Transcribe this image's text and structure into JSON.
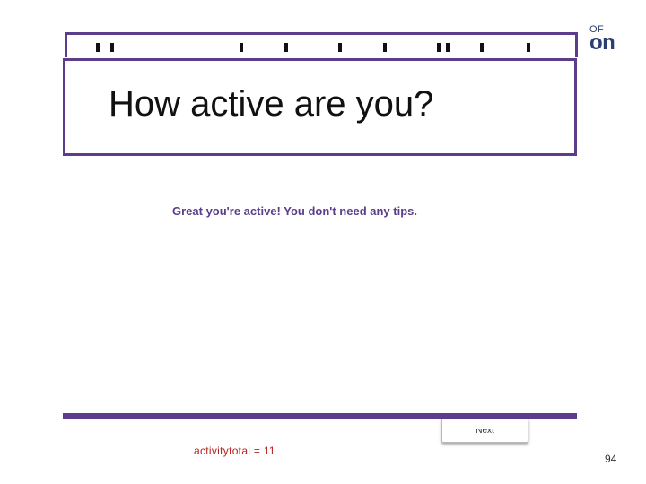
{
  "logo": {
    "line1": "OF",
    "line2": "on"
  },
  "title": "How active are you?",
  "message": "Great you're active! You don't need any tips.",
  "next_button": {
    "label": "Next"
  },
  "activity_total": "activitytotal = 11",
  "page_number": "94",
  "colors": {
    "accent": "#5b3d8c",
    "message_text": "#5b3d8c",
    "variable_text": "#b8201a",
    "logo": "#2c3f72"
  }
}
